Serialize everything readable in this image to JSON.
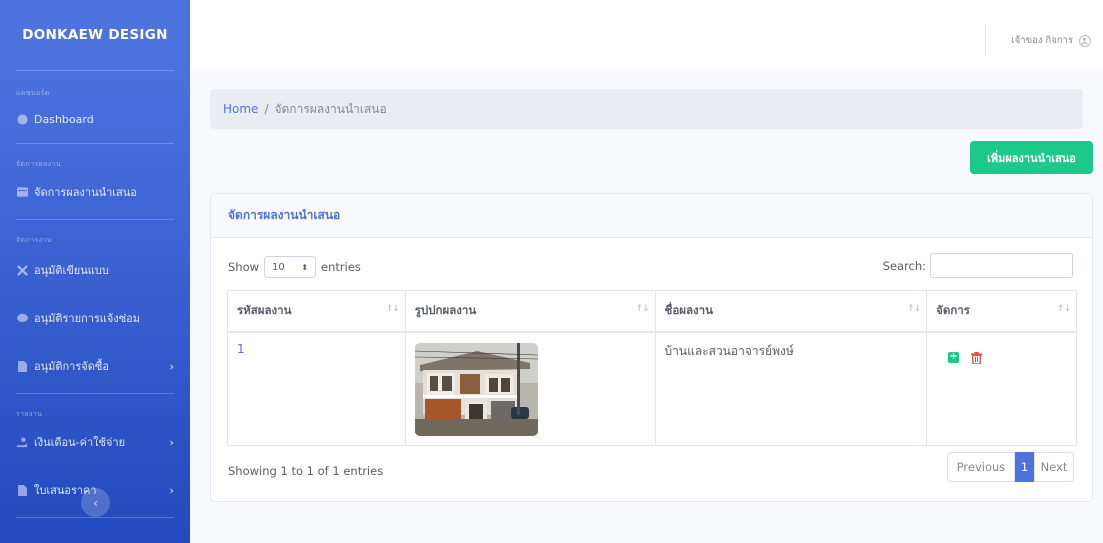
{
  "sidebar": {
    "brand": "DONKAEW DESIGN",
    "sections": [
      {
        "heading": "แดชบอร์ด",
        "items": [
          {
            "label": "Dashboard",
            "icon": "palette-icon",
            "has_arrow": false
          }
        ]
      },
      {
        "heading": "จัดการผลงาน",
        "items": [
          {
            "label": "จัดการผลงานนำเสนอ",
            "icon": "table-icon",
            "has_arrow": false
          }
        ]
      },
      {
        "heading": "จัดการงาน",
        "items": [
          {
            "label": "อนุมัติเขียนแบบ",
            "icon": "tools-icon",
            "has_arrow": false
          },
          {
            "label": "อนุมัติรายการแจ้งซ่อม",
            "icon": "comment-icon",
            "has_arrow": false
          },
          {
            "label": "อนุมัติการจัดซื้อ",
            "icon": "file-icon",
            "has_arrow": true
          }
        ]
      },
      {
        "heading": "รายงาน",
        "items": [
          {
            "label": "เงินเดือน-ค่าใช้จ่าย",
            "icon": "hand-money-icon",
            "has_arrow": true
          },
          {
            "label": "ใบเสนอราคา",
            "icon": "file-icon",
            "has_arrow": true
          }
        ]
      }
    ]
  },
  "topbar": {
    "user_name": "เจ้าของ กิจการ"
  },
  "breadcrumb": {
    "home": "Home",
    "separator": "/",
    "current": "จัดการผลงานนำเสนอ"
  },
  "add_button": "เพิ่มผลงานนำเสนอ",
  "card": {
    "title": "จัดการผลงานนำเสนอ"
  },
  "datatable": {
    "show_label": "Show",
    "entries_value": "10",
    "entries_label": "entries",
    "search_label": "Search:",
    "columns": [
      "รหัสผลงาน",
      "รูปปกผลงาน",
      "ชื่อผลงาน",
      "จัดการ"
    ],
    "rows": [
      {
        "id": "1",
        "name": "บ้านและสวนอาจารย์พงษ์"
      }
    ],
    "info": "Showing 1 to 1 of 1 entries",
    "pagination": {
      "previous": "Previous",
      "page": "1",
      "next": "Next"
    }
  },
  "colors": {
    "primary": "#4e73df",
    "success": "#1cc88a",
    "danger": "#e74a3b"
  }
}
